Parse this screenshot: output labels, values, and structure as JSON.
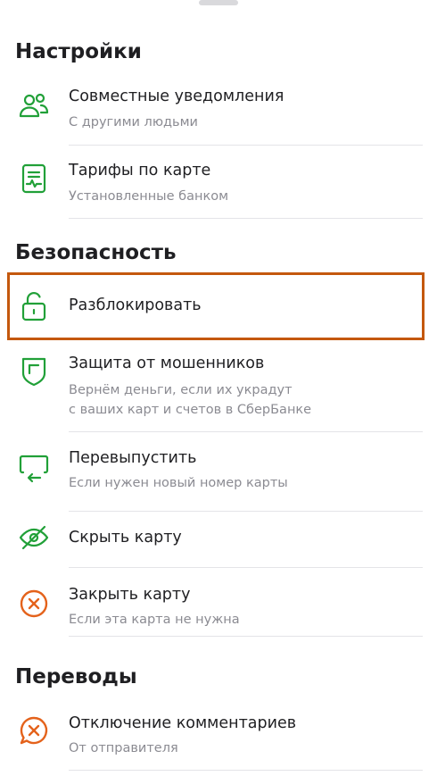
{
  "sections": {
    "settings": "Настройки",
    "security": "Безопасность",
    "transfers": "Переводы"
  },
  "items": {
    "shared_notifications": {
      "title": "Совместные уведомления",
      "subtitle": "С другими людьми",
      "icon": "people-icon"
    },
    "card_tariffs": {
      "title": "Тарифы по карте",
      "subtitle": "Установленные банком",
      "icon": "document-icon"
    },
    "unlock": {
      "title": "Разблокировать",
      "icon": "unlocked-padlock-icon"
    },
    "fraud_protection": {
      "title": "Защита от мошенников",
      "subtitle_line1": "Вернём деньги, если их украдут",
      "subtitle_line2": "с ваших карт и счетов в СберБанке",
      "icon": "shield-icon"
    },
    "reissue": {
      "title": "Перевыпустить",
      "subtitle": "Если нужен новый номер карты",
      "icon": "card-reissue-icon"
    },
    "hide_card": {
      "title": "Скрыть карту",
      "icon": "eye-off-icon"
    },
    "close_card": {
      "title": "Закрыть карту",
      "subtitle": "Если эта карта не нужна",
      "icon": "close-circle-icon"
    },
    "disable_comments": {
      "title": "Отключение комментариев",
      "subtitle": "От отправителя",
      "icon": "comment-off-icon"
    }
  },
  "colors": {
    "green": "#21a038",
    "orange": "#e4621b",
    "highlight": "#c4580e"
  }
}
